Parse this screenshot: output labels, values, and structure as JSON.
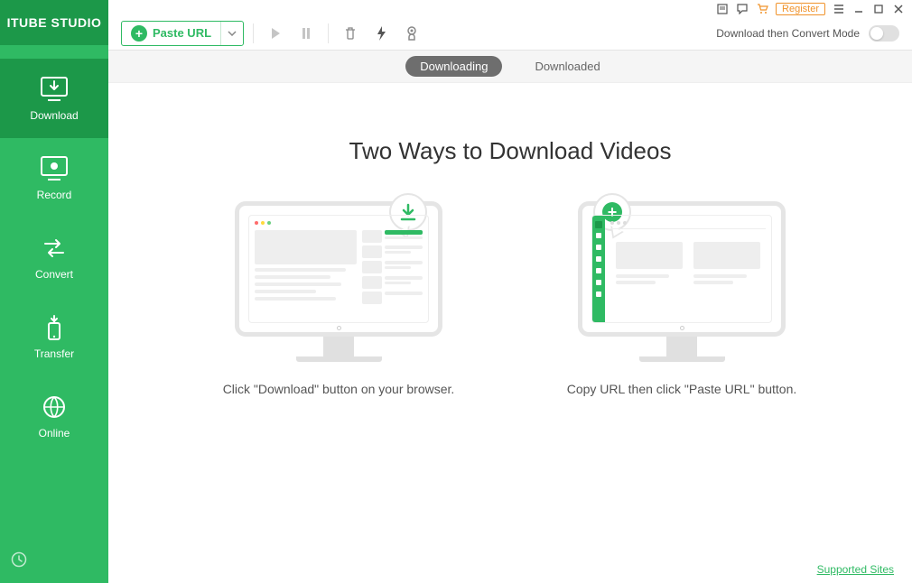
{
  "app": {
    "name": "ITUBE STUDIO"
  },
  "toolbar": {
    "paste_url": "Paste URL",
    "convert_mode": "Download then Convert Mode"
  },
  "titlebar": {
    "register": "Register"
  },
  "sidebar": {
    "items": [
      {
        "label": "Download"
      },
      {
        "label": "Record"
      },
      {
        "label": "Convert"
      },
      {
        "label": "Transfer"
      },
      {
        "label": "Online"
      }
    ]
  },
  "tabs": {
    "downloading": "Downloading",
    "downloaded": "Downloaded"
  },
  "content": {
    "headline": "Two Ways to Download Videos",
    "way1_caption": "Click \"Download\" button on your browser.",
    "way2_caption": "Copy URL then click \"Paste URL\" button."
  },
  "footer": {
    "supported_sites": "Supported Sites"
  },
  "icons": {
    "download": "download-icon",
    "record": "record-icon",
    "convert": "convert-icon",
    "transfer": "transfer-icon",
    "online": "online-icon"
  }
}
